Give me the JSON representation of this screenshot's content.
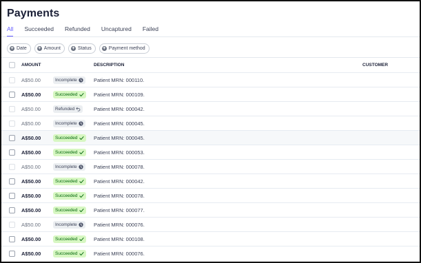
{
  "page": {
    "title": "Payments"
  },
  "tabs": [
    "All",
    "Succeeded",
    "Refunded",
    "Uncaptured",
    "Failed"
  ],
  "filters": [
    "Date",
    "Amount",
    "Status",
    "Payment method"
  ],
  "columns": {
    "amount": "AMOUNT",
    "description": "DESCRIPTION",
    "customer": "CUSTOMER"
  },
  "colors": {
    "accent": "#635bff",
    "succeeded_bg": "#d7f7c2",
    "succeeded_text": "#05690d",
    "neutral_bg": "#ebeef1"
  },
  "rows": [
    {
      "amount": "A$50.00",
      "status": "Incomplete",
      "status_icon": "clock-icon",
      "description": "Patient MRN: 000110."
    },
    {
      "amount": "A$50.00",
      "status": "Succeeded",
      "status_icon": "check-icon",
      "description": "Patient MRN: 000109."
    },
    {
      "amount": "A$50.00",
      "status": "Refunded",
      "status_icon": "undo-arrow-icon",
      "description": "Patient MRN: 000042."
    },
    {
      "amount": "A$50.00",
      "status": "Incomplete",
      "status_icon": "clock-icon",
      "description": "Patient MRN: 000045."
    },
    {
      "amount": "A$50.00",
      "status": "Succeeded",
      "status_icon": "check-icon",
      "description": "Patient MRN: 000045."
    },
    {
      "amount": "A$50.00",
      "status": "Succeeded",
      "status_icon": "check-icon",
      "description": "Patient MRN: 000053."
    },
    {
      "amount": "A$50.00",
      "status": "Incomplete",
      "status_icon": "clock-icon",
      "description": "Patient MRN: 000078."
    },
    {
      "amount": "A$50.00",
      "status": "Succeeded",
      "status_icon": "check-icon",
      "description": "Patient MRN: 000042."
    },
    {
      "amount": "A$50.00",
      "status": "Succeeded",
      "status_icon": "check-icon",
      "description": "Patient MRN: 000078."
    },
    {
      "amount": "A$50.00",
      "status": "Succeeded",
      "status_icon": "check-icon",
      "description": "Patient MRN: 000077."
    },
    {
      "amount": "A$50.00",
      "status": "Incomplete",
      "status_icon": "clock-icon",
      "description": "Patient MRN: 000076."
    },
    {
      "amount": "A$50.00",
      "status": "Succeeded",
      "status_icon": "check-icon",
      "description": "Patient MRN: 000108."
    },
    {
      "amount": "A$50.00",
      "status": "Succeeded",
      "status_icon": "check-icon",
      "description": "Patient MRN: 000076."
    }
  ]
}
